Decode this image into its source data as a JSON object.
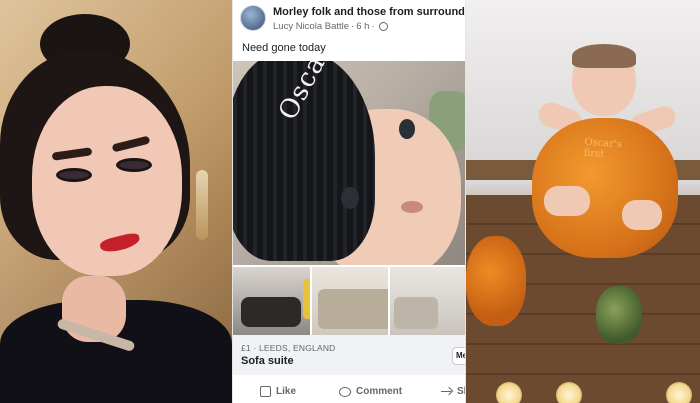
{
  "post": {
    "group_name": "Morley folk and those from surrounding a",
    "author": "Lucy Nicola Battle",
    "time": "6 h",
    "body_text": "Need gone today",
    "photo_caption": "Oscar",
    "listing": {
      "price_location": "£1 · LEEDS, ENGLAND",
      "title": "Sofa suite",
      "message_button_label": "Me"
    },
    "actions": {
      "like_label": "Like",
      "comment_label": "Comment",
      "share_label": "Sh"
    }
  },
  "right_photo": {
    "pumpkin_text": "Oscar's\nfirst"
  },
  "colors": {
    "facebook_text": "#1c1e21",
    "facebook_meta": "#65676b",
    "listing_bg": "#f0f2f5"
  },
  "icons": [
    "globe-icon",
    "like-icon",
    "comment-icon",
    "share-icon"
  ]
}
